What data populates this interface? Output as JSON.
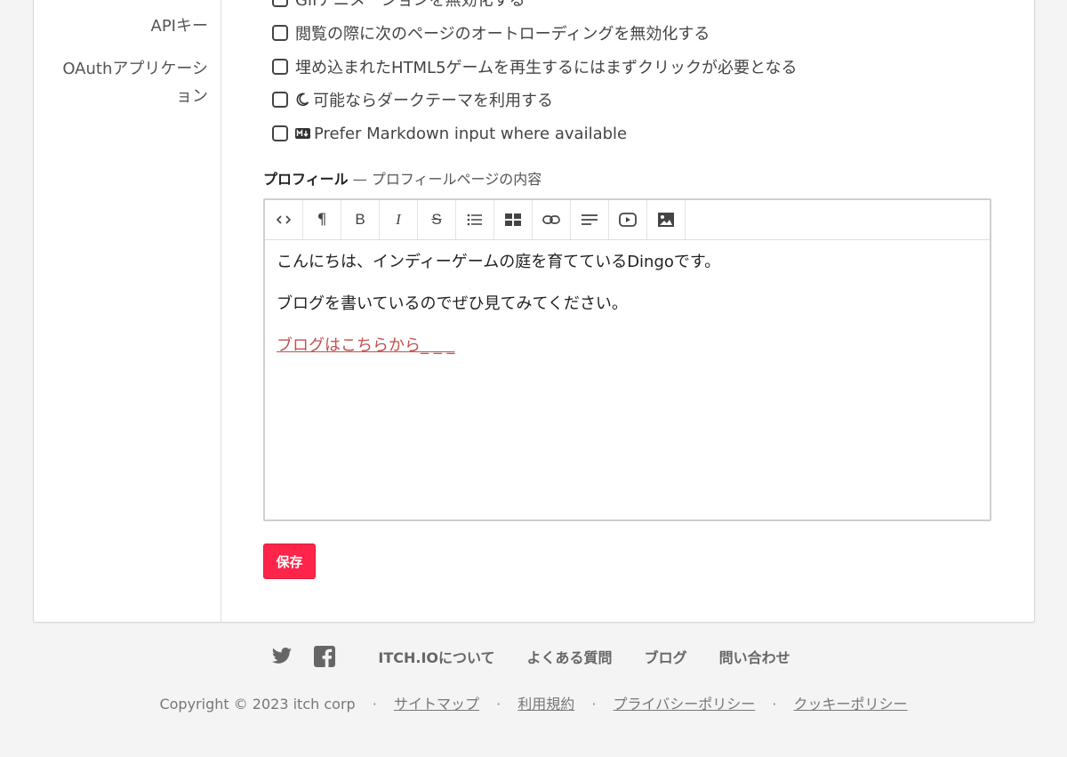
{
  "sidebar": {
    "items": [
      {
        "label": "APIキー"
      },
      {
        "label": "OAuthアプリケーション"
      }
    ]
  },
  "preferences": {
    "items": [
      {
        "label": "Gifアニメーションを無効化する",
        "checked": false
      },
      {
        "label": "閲覧の際に次のページのオートローディングを無効化する",
        "checked": false
      },
      {
        "label": "埋め込まれたHTML5ゲームを再生するにはまずクリックが必要となる",
        "checked": false
      },
      {
        "label": "可能ならダークテーマを利用する",
        "checked": false,
        "icon": "moon-icon"
      },
      {
        "label": "Prefer Markdown input where available",
        "checked": false,
        "icon": "markdown-icon"
      }
    ]
  },
  "profile": {
    "label": "プロフィール",
    "hint": "— プロフィールページの内容",
    "toolbar": [
      {
        "icon": "code-icon",
        "glyph": "<>"
      },
      {
        "icon": "paragraph-icon",
        "glyph": "¶"
      },
      {
        "icon": "bold-icon",
        "glyph": "B"
      },
      {
        "icon": "italic-icon",
        "glyph": "I"
      },
      {
        "icon": "strikethrough-icon",
        "glyph": "S"
      },
      {
        "icon": "bullet-list-icon",
        "glyph": ""
      },
      {
        "icon": "table-icon",
        "glyph": ""
      },
      {
        "icon": "link-icon",
        "glyph": ""
      },
      {
        "icon": "align-left-icon",
        "glyph": ""
      },
      {
        "icon": "video-icon",
        "glyph": ""
      },
      {
        "icon": "image-icon",
        "glyph": ""
      }
    ],
    "content": {
      "line1": "こんにちは、インディーゲームの庭を育てているDingoです。",
      "line2": "ブログを書いているのでぜひ見てみてください。",
      "link": "ブログはこちらから_ _ _"
    }
  },
  "save_button": "保存",
  "colors": {
    "save_button": "#ff2449",
    "link": "#c15050"
  },
  "footer": {
    "social": [
      "twitter-icon",
      "facebook-icon"
    ],
    "links": [
      "ITCH.IOについて",
      "よくある質問",
      "ブログ",
      "問い合わせ"
    ],
    "copyright": "Copyright © 2023 itch corp",
    "legal": [
      "サイトマップ",
      "利用規約",
      "プライバシーポリシー",
      "クッキーポリシー"
    ]
  }
}
